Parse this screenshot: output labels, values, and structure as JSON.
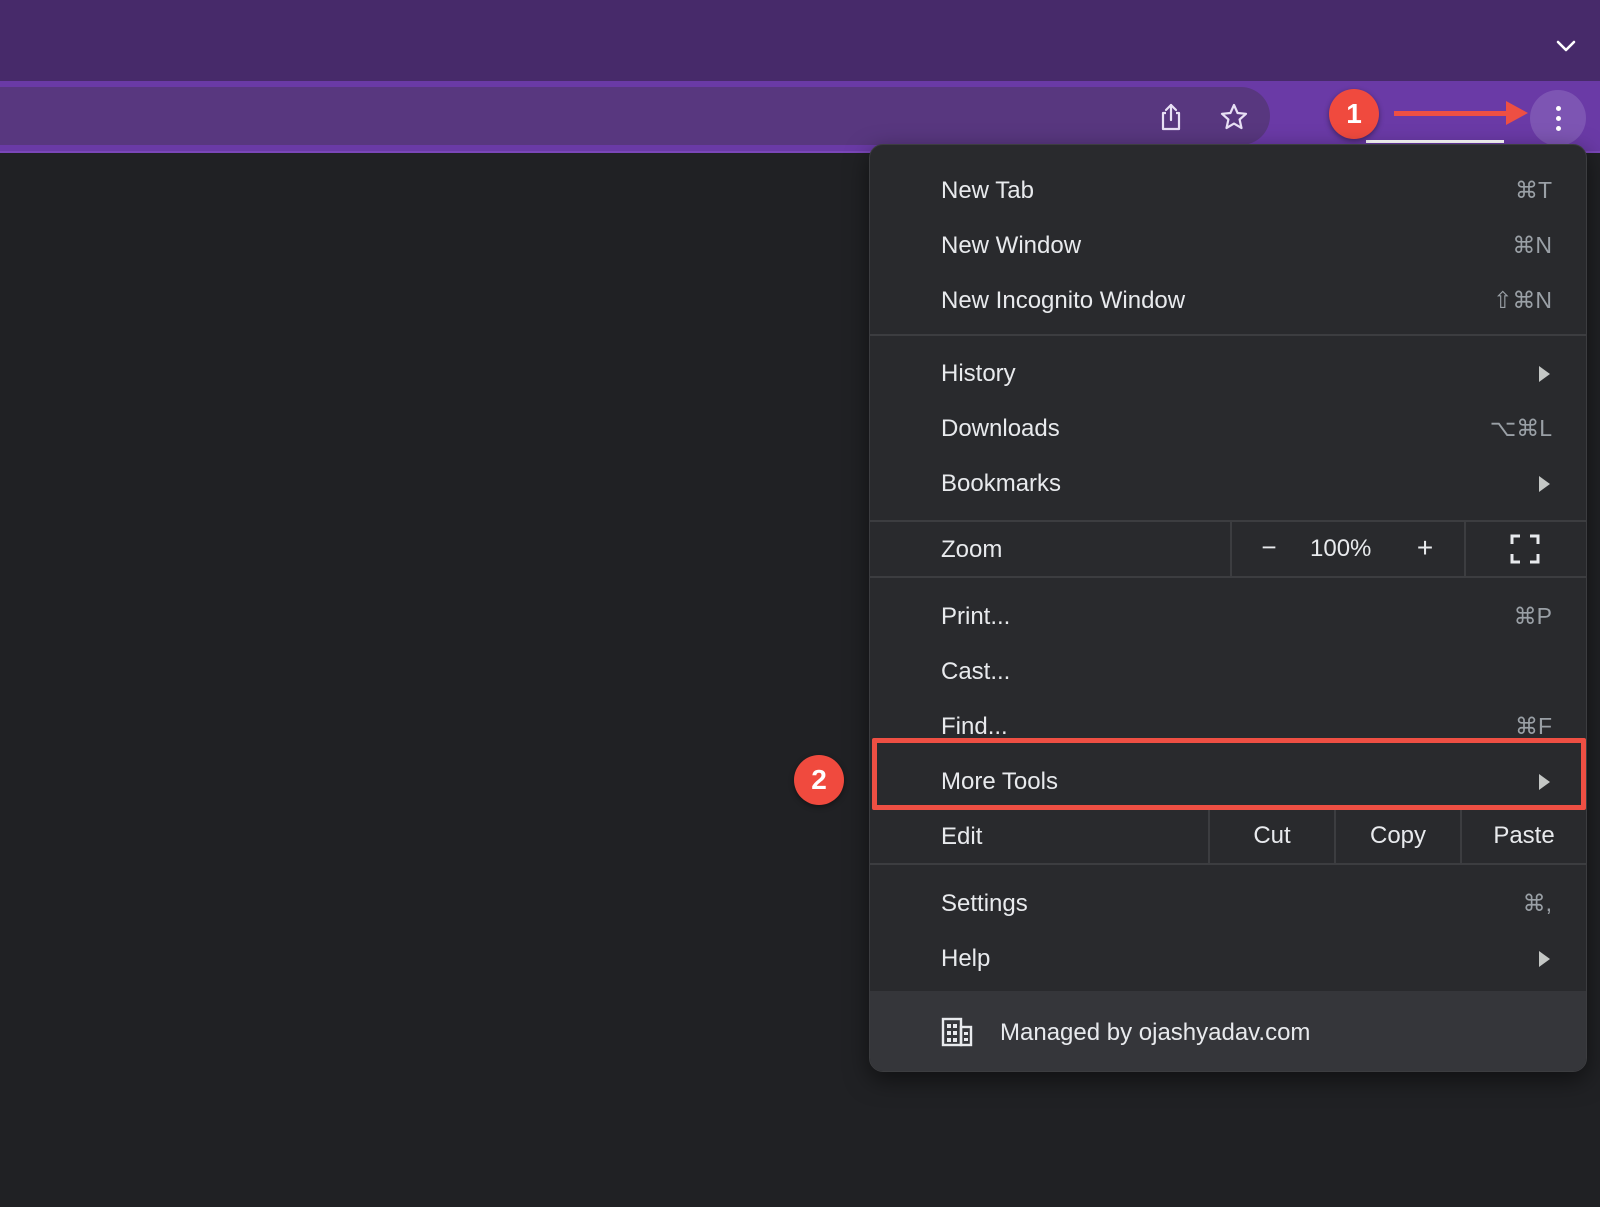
{
  "menu": {
    "items_top": [
      {
        "label": "New Tab",
        "shortcut": "⌘T"
      },
      {
        "label": "New Window",
        "shortcut": "⌘N"
      },
      {
        "label": "New Incognito Window",
        "shortcut": "⇧⌘N"
      }
    ],
    "items_mid": [
      {
        "label": "History",
        "shortcut": ""
      },
      {
        "label": "Downloads",
        "shortcut": "⌥⌘L"
      },
      {
        "label": "Bookmarks",
        "shortcut": ""
      }
    ],
    "zoom": {
      "label": "Zoom",
      "minus": "−",
      "value": "100%",
      "plus": "+"
    },
    "items_tools": [
      {
        "label": "Print...",
        "shortcut": "⌘P"
      },
      {
        "label": "Cast...",
        "shortcut": ""
      },
      {
        "label": "Find...",
        "shortcut": "⌘F"
      },
      {
        "label": "More Tools",
        "shortcut": ""
      }
    ],
    "edit": {
      "label": "Edit",
      "cut": "Cut",
      "copy": "Copy",
      "paste": "Paste"
    },
    "items_bottom": [
      {
        "label": "Settings",
        "shortcut": "⌘,"
      },
      {
        "label": "Help",
        "shortcut": ""
      }
    ],
    "managed_text": "Managed by ojashyadav.com"
  },
  "annotations": {
    "badge_1": "1",
    "badge_2": "2",
    "color": "#ee4f43"
  },
  "icons": [
    "chevron-down-icon",
    "share-icon",
    "star-icon",
    "kebab-menu-icon",
    "fullscreen-icon",
    "building-icon",
    "submenu-arrow-icon"
  ],
  "colors": {
    "tabstrip": "#472a6a",
    "toolbar": "#6a3aa6",
    "menu_bg": "#292a2d",
    "page_bg": "#202124"
  }
}
